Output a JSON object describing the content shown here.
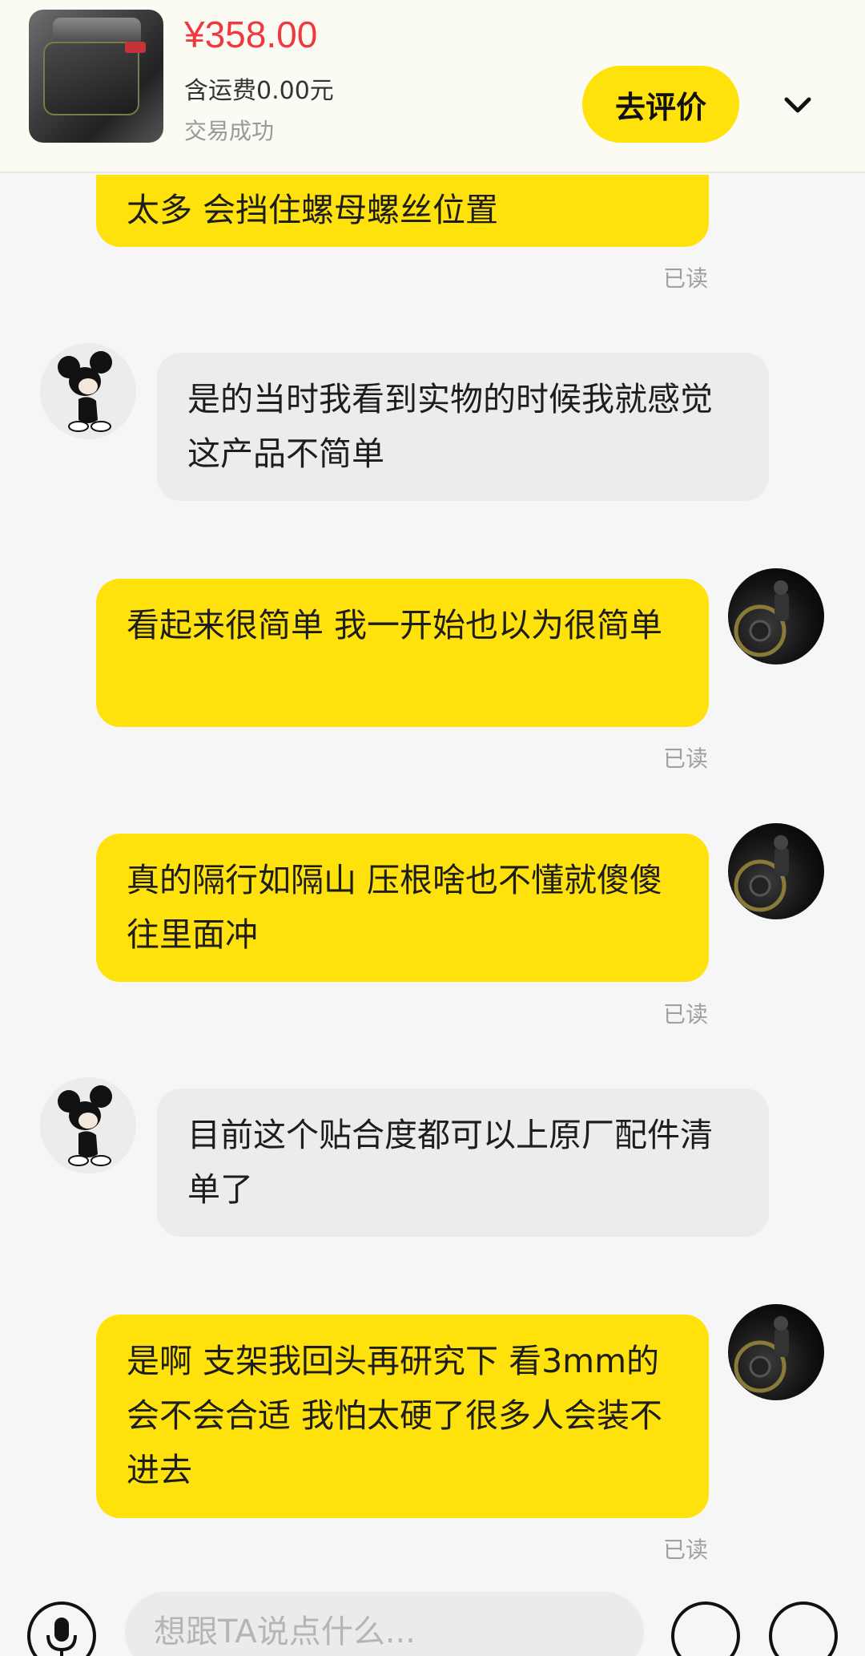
{
  "header": {
    "price": "¥358.00",
    "shipping": "含运费0.00元",
    "status": "交易成功",
    "review_button": "去评价"
  },
  "messages": [
    {
      "sender": "me",
      "text": "太多 会挡住螺母螺丝位置",
      "status": "已读"
    },
    {
      "sender": "them",
      "text": "是的当时我看到实物的时候我就感觉这产品不简单"
    },
    {
      "sender": "me",
      "text": "看起来很简单 我一开始也以为很简单",
      "status": "已读"
    },
    {
      "sender": "me",
      "text": "真的隔行如隔山 压根啥也不懂就傻傻往里面冲",
      "status": "已读"
    },
    {
      "sender": "them",
      "text": "目前这个贴合度都可以上原厂配件清单了"
    },
    {
      "sender": "me",
      "text": "是啊 支架我回头再研究下 看3mm的会不会合适 我怕太硬了很多人会装不进去",
      "status": "已读"
    }
  ],
  "input": {
    "placeholder": "想跟TA说点什么..."
  },
  "colors": {
    "accent_yellow": "#ffe20c",
    "price_red": "#f0393f",
    "bubble_gray": "#ececec"
  },
  "icons": [
    "chevron-down-icon",
    "microphone-icon",
    "emoji-icon",
    "add-icon"
  ]
}
